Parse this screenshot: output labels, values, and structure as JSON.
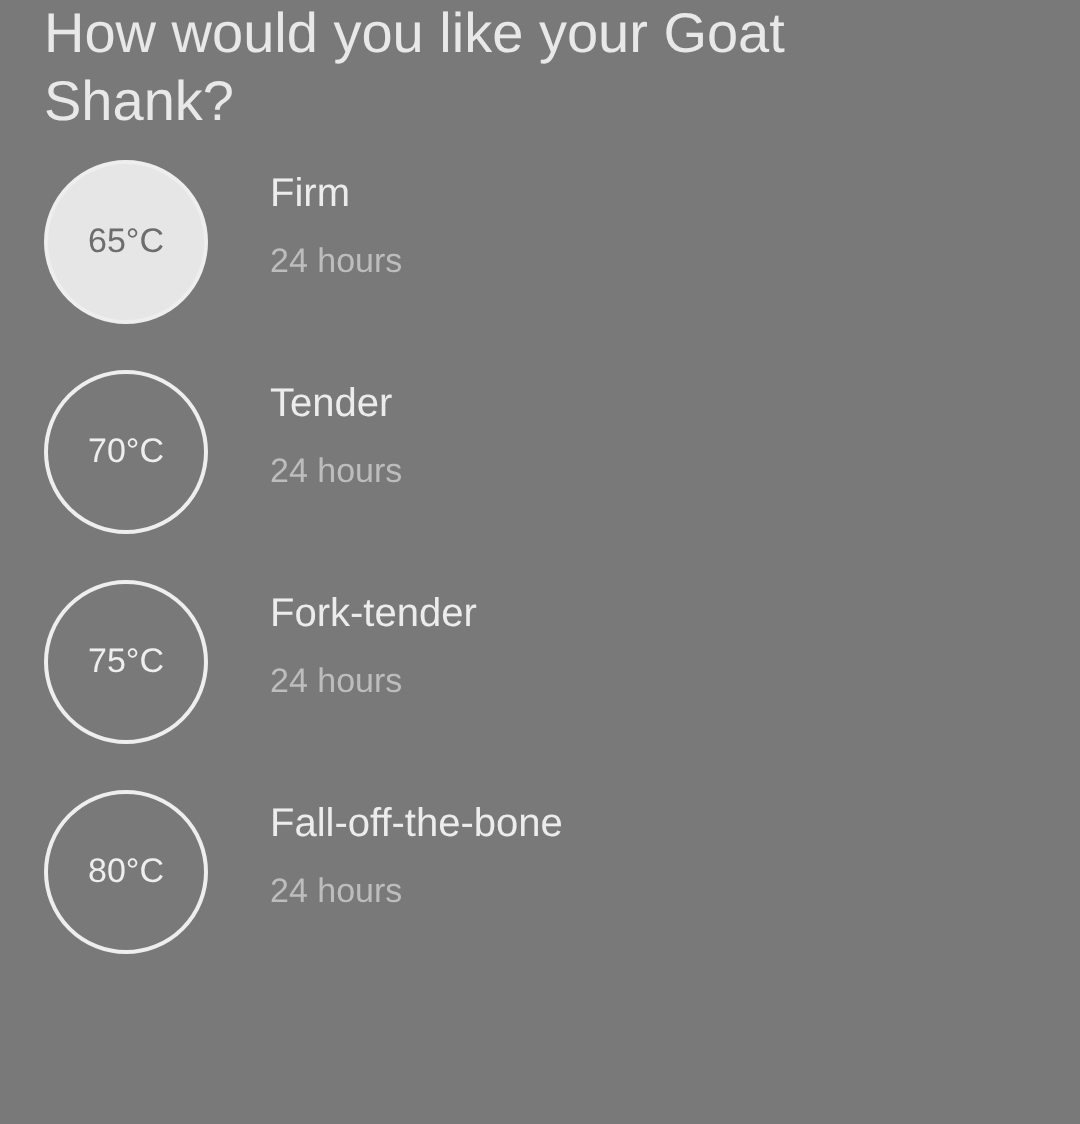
{
  "title": "How would you like your Goat Shank?",
  "options": [
    {
      "temperature": "65°C",
      "name": "Firm",
      "duration": "24 hours",
      "selected": true
    },
    {
      "temperature": "70°C",
      "name": "Tender",
      "duration": "24 hours",
      "selected": false
    },
    {
      "temperature": "75°C",
      "name": "Fork-tender",
      "duration": "24 hours",
      "selected": false
    },
    {
      "temperature": "80°C",
      "name": "Fall-off-the-bone",
      "duration": "24 hours",
      "selected": false
    }
  ]
}
